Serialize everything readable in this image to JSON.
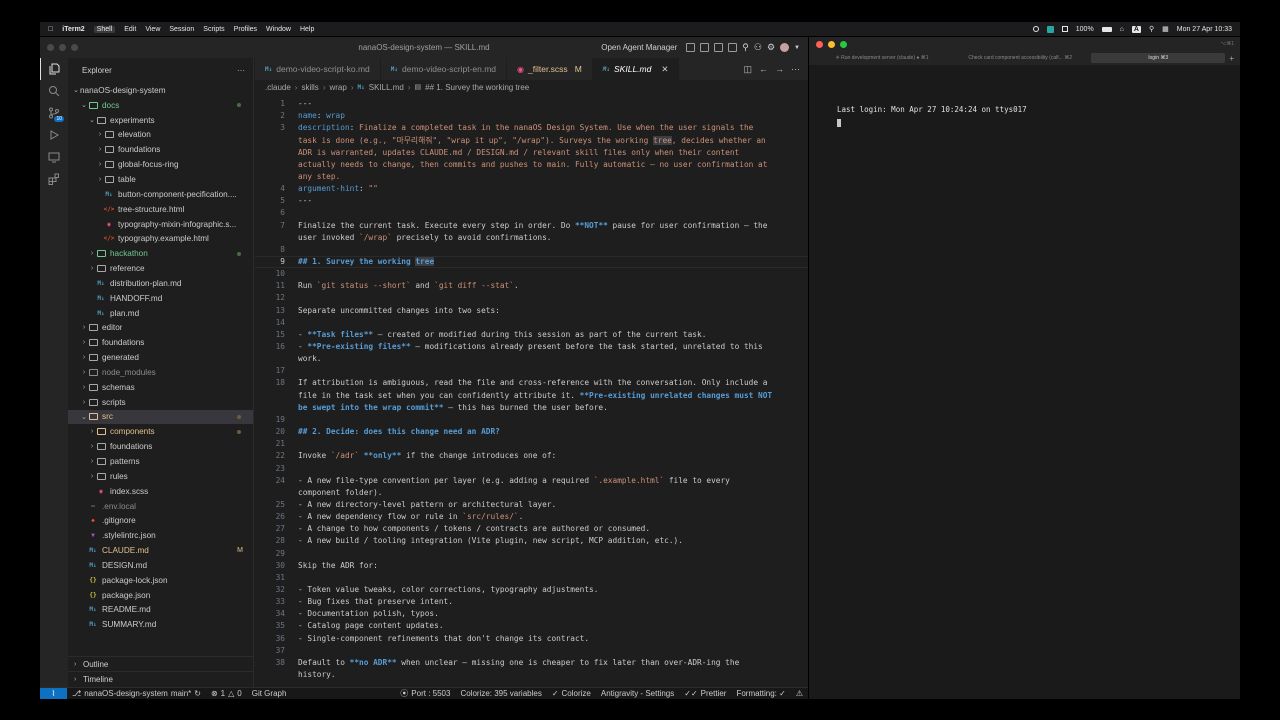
{
  "menubar": {
    "app": "iTerm2",
    "items": [
      "Shell",
      "Edit",
      "View",
      "Session",
      "Scripts",
      "Profiles",
      "Window",
      "Help"
    ],
    "battery": "100%",
    "input": "A",
    "datetime": "Mon 27 Apr  10:33"
  },
  "vscode": {
    "window_title": "nanaOS-design-system — SKILL.md",
    "open_agent_manager": "Open Agent Manager",
    "explorer_title": "Explorer",
    "scm_badge": "10",
    "root": "nanaOS-design-system",
    "tree": [
      {
        "label": "docs",
        "indent": 1,
        "type": "folder-open",
        "color": "green",
        "dot": true
      },
      {
        "label": "experiments",
        "indent": 2,
        "type": "folder-open",
        "color": "white"
      },
      {
        "label": "elevation",
        "indent": 3,
        "type": "folder",
        "color": "white"
      },
      {
        "label": "foundations",
        "indent": 3,
        "type": "folder",
        "color": "white"
      },
      {
        "label": "global-focus-ring",
        "indent": 3,
        "type": "folder",
        "color": "white"
      },
      {
        "label": "table",
        "indent": 3,
        "type": "folder",
        "color": "white"
      },
      {
        "label": "button-component-pecification....",
        "indent": 3,
        "type": "md",
        "color": "white"
      },
      {
        "label": "tree-structure.html",
        "indent": 3,
        "type": "html",
        "color": "white"
      },
      {
        "label": "typography-mixin-infographic.s...",
        "indent": 3,
        "type": "sass",
        "color": "white"
      },
      {
        "label": "typography.example.html",
        "indent": 3,
        "type": "html",
        "color": "white"
      },
      {
        "label": "hackathon",
        "indent": 2,
        "type": "folder",
        "color": "green",
        "dot": true
      },
      {
        "label": "reference",
        "indent": 2,
        "type": "folder",
        "color": "white"
      },
      {
        "label": "distribution-plan.md",
        "indent": 2,
        "type": "md",
        "color": "white"
      },
      {
        "label": "HANDOFF.md",
        "indent": 2,
        "type": "md",
        "color": "white"
      },
      {
        "label": "plan.md",
        "indent": 2,
        "type": "md",
        "color": "white"
      },
      {
        "label": "editor",
        "indent": 1,
        "type": "folder",
        "color": "white"
      },
      {
        "label": "foundations",
        "indent": 1,
        "type": "folder",
        "color": "white"
      },
      {
        "label": "generated",
        "indent": 1,
        "type": "folder",
        "color": "white"
      },
      {
        "label": "node_modules",
        "indent": 1,
        "type": "folder",
        "color": "grey"
      },
      {
        "label": "schemas",
        "indent": 1,
        "type": "folder",
        "color": "white"
      },
      {
        "label": "scripts",
        "indent": 1,
        "type": "folder",
        "color": "white"
      },
      {
        "label": "src",
        "indent": 1,
        "type": "folder-open",
        "color": "yellow",
        "dot": true,
        "selected": true
      },
      {
        "label": "components",
        "indent": 2,
        "type": "folder",
        "color": "yellow",
        "dot": true
      },
      {
        "label": "foundations",
        "indent": 2,
        "type": "folder",
        "color": "white"
      },
      {
        "label": "patterns",
        "indent": 2,
        "type": "folder",
        "color": "white"
      },
      {
        "label": "rules",
        "indent": 2,
        "type": "folder",
        "color": "white"
      },
      {
        "label": "index.scss",
        "indent": 2,
        "type": "sass",
        "color": "white"
      },
      {
        "label": ".env.local",
        "indent": 1,
        "type": "env",
        "color": "grey"
      },
      {
        "label": ".gitignore",
        "indent": 1,
        "type": "git",
        "color": "white"
      },
      {
        "label": ".stylelintrc.json",
        "indent": 1,
        "type": "stylelint",
        "color": "white"
      },
      {
        "label": "CLAUDE.md",
        "indent": 1,
        "type": "md",
        "color": "yellow",
        "deco": "M"
      },
      {
        "label": "DESIGN.md",
        "indent": 1,
        "type": "md",
        "color": "white"
      },
      {
        "label": "package-lock.json",
        "indent": 1,
        "type": "json",
        "color": "white"
      },
      {
        "label": "package.json",
        "indent": 1,
        "type": "json",
        "color": "white"
      },
      {
        "label": "README.md",
        "indent": 1,
        "type": "md",
        "color": "white"
      },
      {
        "label": "SUMMARY.md",
        "indent": 1,
        "type": "md",
        "color": "white"
      }
    ],
    "outline": "Outline",
    "timeline": "Timeline",
    "tabs": [
      {
        "label": "demo-video-script-ko.md",
        "icon": "md"
      },
      {
        "label": "demo-video-script-en.md",
        "icon": "md"
      },
      {
        "label": "_filter.scss",
        "icon": "sass",
        "modified": "M"
      },
      {
        "label": "SKILL.md",
        "icon": "md",
        "active": true
      }
    ],
    "breadcrumb": [
      ".claude",
      "skills",
      "wrap",
      "SKILL.md",
      "## 1. Survey the working tree"
    ],
    "current_line": "9",
    "statusbar": {
      "branch_repo": "nanaOS-design-system",
      "branch": "main*",
      "errors": "1",
      "warnings": "0",
      "git_graph": "Git Graph",
      "port": "Port : 5503",
      "colorize_vars": "Colorize: 395 variables",
      "colorize": "Colorize",
      "antigravity": "Antigravity - Settings",
      "prettier": "Prettier",
      "formatting": "Formatting: ✓"
    }
  },
  "code_lines": [
    {
      "n": "1",
      "html": "---"
    },
    {
      "n": "2",
      "html": "<span class=\"kw\">name</span>: <span class=\"kw\">wrap</span>"
    },
    {
      "n": "3",
      "html": "<span class=\"kw\">description</span>: <span class=\"str\">Finalize a completed task in the nanaOS Design System. Use when the user signals the</span>"
    },
    {
      "n": "",
      "html": "<span class=\"str\">task is done (e.g., \"마무리해줘\", \"wrap it up\", \"/wrap\"). Surveys the working <span class=\"hl\">tree</span>, decides whether an</span>"
    },
    {
      "n": "",
      "html": "<span class=\"str\">ADR is warranted, updates CLAUDE.md / DESIGN.md / relevant skill files only when their content</span>"
    },
    {
      "n": "",
      "html": "<span class=\"str\">actually needs to change, then commits and pushes to main. Fully automatic — no user confirmation at</span>"
    },
    {
      "n": "",
      "html": "<span class=\"str\">any step.</span>"
    },
    {
      "n": "4",
      "html": "<span class=\"kw\">argument-hint</span>: <span class=\"str\">\"\"</span>"
    },
    {
      "n": "5",
      "html": "---"
    },
    {
      "n": "6",
      "html": ""
    },
    {
      "n": "7",
      "html": "Finalize the current task. Execute every step in order. Do <span class=\"bd\">**NOT**</span> pause for user confirmation — the"
    },
    {
      "n": "",
      "html": "user invoked <span class=\"cd\">`/wrap`</span> precisely to avoid confirmations."
    },
    {
      "n": "8",
      "html": ""
    },
    {
      "n": "9",
      "html": "<span class=\"hd\">## 1. Survey the working <span class=\"hl\">tree</span></span>",
      "cur": true
    },
    {
      "n": "10",
      "html": ""
    },
    {
      "n": "11",
      "html": "Run <span class=\"cd\">`git status --short`</span> and <span class=\"cd\">`git diff --stat`</span>."
    },
    {
      "n": "12",
      "html": ""
    },
    {
      "n": "13",
      "html": "Separate uncommitted changes into two sets:"
    },
    {
      "n": "14",
      "html": ""
    },
    {
      "n": "15",
      "html": "- <span class=\"bd\">**Task files**</span> — created or modified during this session as part of the current task."
    },
    {
      "n": "16",
      "html": "- <span class=\"bd\">**Pre-existing files**</span> — modifications already present before the task started, unrelated to this"
    },
    {
      "n": "",
      "html": "work."
    },
    {
      "n": "17",
      "html": ""
    },
    {
      "n": "18",
      "html": "If attribution is ambiguous, read the file and cross-reference with the conversation. Only include a"
    },
    {
      "n": "",
      "html": "file in the task set when you can confidently attribute it. <span class=\"bd\">**Pre-existing unrelated changes must NOT</span>"
    },
    {
      "n": "",
      "html": "<span class=\"bd\">be swept into the wrap commit**</span> — this has burned the user before."
    },
    {
      "n": "19",
      "html": ""
    },
    {
      "n": "20",
      "html": "<span class=\"hd\">## 2. Decide: does this change need an ADR?</span>"
    },
    {
      "n": "21",
      "html": ""
    },
    {
      "n": "22",
      "html": "Invoke <span class=\"cd\">`/adr`</span> <span class=\"bd\">**only**</span> if the change introduces one of:"
    },
    {
      "n": "23",
      "html": ""
    },
    {
      "n": "24",
      "html": "- A new file-type convention per layer (e.g. adding a required <span class=\"cd\">`.example.html`</span> file to every"
    },
    {
      "n": "",
      "html": "component folder)."
    },
    {
      "n": "25",
      "html": "- A new directory-level pattern or architectural layer."
    },
    {
      "n": "26",
      "html": "- A new dependency flow or rule in <span class=\"cd\">`src/rules/`</span>."
    },
    {
      "n": "27",
      "html": "- A change to how components / tokens / contracts are authored or consumed."
    },
    {
      "n": "28",
      "html": "- A new build / tooling integration (Vite plugin, new script, MCP addition, etc.)."
    },
    {
      "n": "29",
      "html": ""
    },
    {
      "n": "30",
      "html": "Skip the ADR for:"
    },
    {
      "n": "31",
      "html": ""
    },
    {
      "n": "32",
      "html": "- Token value tweaks, color corrections, typography adjustments."
    },
    {
      "n": "33",
      "html": "- Bug fixes that preserve intent."
    },
    {
      "n": "34",
      "html": "- Documentation polish, typos."
    },
    {
      "n": "35",
      "html": "- Catalog page content updates."
    },
    {
      "n": "36",
      "html": "- Single-component refinements that don't change its contract."
    },
    {
      "n": "37",
      "html": ""
    },
    {
      "n": "38",
      "html": "Default to <span class=\"bd\">**no ADR**</span> when unclear — missing one is cheaper to fix later than over-ADR-ing the"
    },
    {
      "n": "",
      "html": "history."
    }
  ],
  "iterm": {
    "tabs": [
      {
        "label": "✳ Run development server (claude) ● ⌘1"
      },
      {
        "label": "Check card component accessibility (calf... ⌘2"
      },
      {
        "label": "login ⌘3",
        "active": true
      }
    ],
    "shortcut": "⌥⌘1",
    "login_line": "Last login: Mon Apr 27 10:24:24 on ttys017"
  },
  "colors": {
    "accent": "#0e70c0",
    "git_added": "#73c991",
    "git_modified": "#e2c08d"
  }
}
